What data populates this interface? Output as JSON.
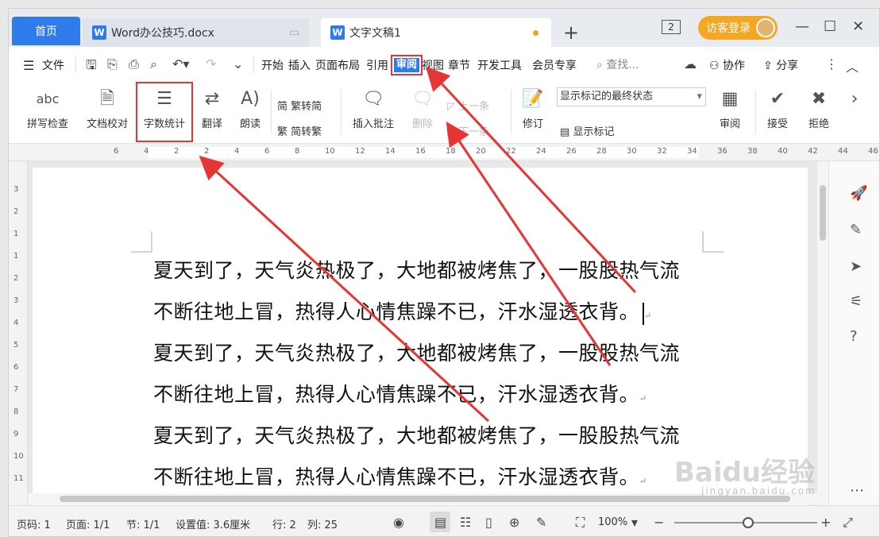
{
  "tabs": {
    "home": "首页",
    "doc1": "Word办公技巧.docx",
    "doc2": "文字文稿1",
    "word_icon": "W",
    "add": "+"
  },
  "window": {
    "counter": "2",
    "login": "访客登录",
    "minimize": "—",
    "maximize": "☐",
    "close": "✕"
  },
  "menu": {
    "file": "文件",
    "items": [
      "开始",
      "插入",
      "页面布局",
      "引用",
      "审阅",
      "视图",
      "章节",
      "开发工具",
      "会员专享"
    ],
    "active": "审阅",
    "search_placeholder": "查找...",
    "collab": "协作",
    "share": "分享"
  },
  "toolbar": {
    "spell_check": "拼写检查",
    "spell_glyph": "abc",
    "doc_proof": "文档校对",
    "word_count": "字数统计",
    "translate": "翻译",
    "read_aloud": "朗读",
    "trad_to_simp": "繁转简",
    "simp_to_trad": "简转繁",
    "insert_comment": "插入批注",
    "delete": "删除",
    "prev": "上一条",
    "next": "下一条",
    "revise": "修订",
    "markup_state": "显示标记的最终状态",
    "show_markup": "显示标记",
    "review": "审阅",
    "accept": "接受",
    "reject": "拒绝"
  },
  "ruler": {
    "h_ticks": [
      "6",
      "4",
      "2",
      "2",
      "4",
      "6",
      "8",
      "10",
      "12",
      "14",
      "16",
      "18",
      "20",
      "22",
      "24",
      "26",
      "28",
      "30",
      "32",
      "34",
      "36",
      "38",
      "40",
      "42",
      "44",
      "46"
    ],
    "v_ticks": [
      "3",
      "2",
      "1",
      "1",
      "2",
      "3",
      "4",
      "5",
      "6",
      "7",
      "8",
      "9",
      "10",
      "11"
    ]
  },
  "document": {
    "lines": [
      "夏天到了，天气炎热极了，大地都被烤焦了，一股股热气流",
      "不断往地上冒，热得人心情焦躁不已，汗水湿透衣背。",
      "夏天到了，天气炎热极了，大地都被烤焦了，一股股热气流",
      "不断往地上冒，热得人心情焦躁不已，汗水湿透衣背。",
      "夏天到了，天气炎热极了，大地都被烤焦了，一股股热气流",
      "不断往地上冒，热得人心情焦躁不已，汗水湿透衣背。"
    ],
    "para_mark": "↵"
  },
  "status": {
    "page_code": "页码: 1",
    "pages": "页面: 1/1",
    "section": "节: 1/1",
    "setting": "设置值: 3.6厘米",
    "row": "行: 2",
    "col": "列: 25",
    "zoom": "100%"
  },
  "watermark": {
    "brand": "Baidu经验",
    "url": "jingyan.baidu.com"
  },
  "colors": {
    "accent": "#2f7bec",
    "highlight_red": "#e53535",
    "login_orange": "#f5a623"
  }
}
